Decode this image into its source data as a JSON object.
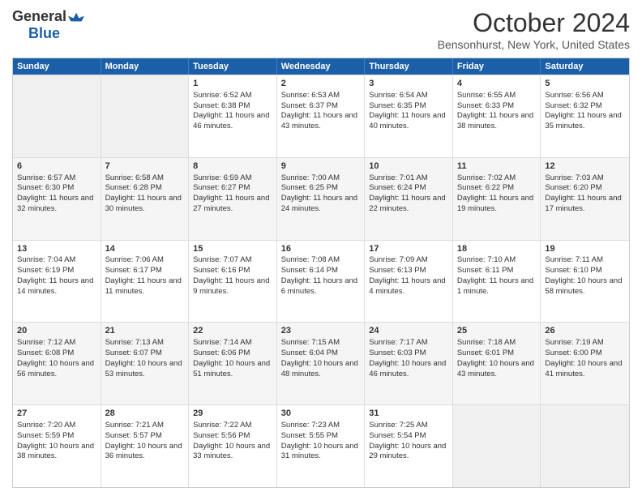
{
  "header": {
    "logo": {
      "general": "General",
      "blue": "Blue"
    },
    "title": "October 2024",
    "location": "Bensonhurst, New York, United States"
  },
  "days_of_week": [
    "Sunday",
    "Monday",
    "Tuesday",
    "Wednesday",
    "Thursday",
    "Friday",
    "Saturday"
  ],
  "weeks": [
    [
      {
        "day": "",
        "sunrise": "",
        "sunset": "",
        "daylight": ""
      },
      {
        "day": "",
        "sunrise": "",
        "sunset": "",
        "daylight": ""
      },
      {
        "day": "1",
        "sunrise": "Sunrise: 6:52 AM",
        "sunset": "Sunset: 6:38 PM",
        "daylight": "Daylight: 11 hours and 46 minutes."
      },
      {
        "day": "2",
        "sunrise": "Sunrise: 6:53 AM",
        "sunset": "Sunset: 6:37 PM",
        "daylight": "Daylight: 11 hours and 43 minutes."
      },
      {
        "day": "3",
        "sunrise": "Sunrise: 6:54 AM",
        "sunset": "Sunset: 6:35 PM",
        "daylight": "Daylight: 11 hours and 40 minutes."
      },
      {
        "day": "4",
        "sunrise": "Sunrise: 6:55 AM",
        "sunset": "Sunset: 6:33 PM",
        "daylight": "Daylight: 11 hours and 38 minutes."
      },
      {
        "day": "5",
        "sunrise": "Sunrise: 6:56 AM",
        "sunset": "Sunset: 6:32 PM",
        "daylight": "Daylight: 11 hours and 35 minutes."
      }
    ],
    [
      {
        "day": "6",
        "sunrise": "Sunrise: 6:57 AM",
        "sunset": "Sunset: 6:30 PM",
        "daylight": "Daylight: 11 hours and 32 minutes."
      },
      {
        "day": "7",
        "sunrise": "Sunrise: 6:58 AM",
        "sunset": "Sunset: 6:28 PM",
        "daylight": "Daylight: 11 hours and 30 minutes."
      },
      {
        "day": "8",
        "sunrise": "Sunrise: 6:59 AM",
        "sunset": "Sunset: 6:27 PM",
        "daylight": "Daylight: 11 hours and 27 minutes."
      },
      {
        "day": "9",
        "sunrise": "Sunrise: 7:00 AM",
        "sunset": "Sunset: 6:25 PM",
        "daylight": "Daylight: 11 hours and 24 minutes."
      },
      {
        "day": "10",
        "sunrise": "Sunrise: 7:01 AM",
        "sunset": "Sunset: 6:24 PM",
        "daylight": "Daylight: 11 hours and 22 minutes."
      },
      {
        "day": "11",
        "sunrise": "Sunrise: 7:02 AM",
        "sunset": "Sunset: 6:22 PM",
        "daylight": "Daylight: 11 hours and 19 minutes."
      },
      {
        "day": "12",
        "sunrise": "Sunrise: 7:03 AM",
        "sunset": "Sunset: 6:20 PM",
        "daylight": "Daylight: 11 hours and 17 minutes."
      }
    ],
    [
      {
        "day": "13",
        "sunrise": "Sunrise: 7:04 AM",
        "sunset": "Sunset: 6:19 PM",
        "daylight": "Daylight: 11 hours and 14 minutes."
      },
      {
        "day": "14",
        "sunrise": "Sunrise: 7:06 AM",
        "sunset": "Sunset: 6:17 PM",
        "daylight": "Daylight: 11 hours and 11 minutes."
      },
      {
        "day": "15",
        "sunrise": "Sunrise: 7:07 AM",
        "sunset": "Sunset: 6:16 PM",
        "daylight": "Daylight: 11 hours and 9 minutes."
      },
      {
        "day": "16",
        "sunrise": "Sunrise: 7:08 AM",
        "sunset": "Sunset: 6:14 PM",
        "daylight": "Daylight: 11 hours and 6 minutes."
      },
      {
        "day": "17",
        "sunrise": "Sunrise: 7:09 AM",
        "sunset": "Sunset: 6:13 PM",
        "daylight": "Daylight: 11 hours and 4 minutes."
      },
      {
        "day": "18",
        "sunrise": "Sunrise: 7:10 AM",
        "sunset": "Sunset: 6:11 PM",
        "daylight": "Daylight: 11 hours and 1 minute."
      },
      {
        "day": "19",
        "sunrise": "Sunrise: 7:11 AM",
        "sunset": "Sunset: 6:10 PM",
        "daylight": "Daylight: 10 hours and 58 minutes."
      }
    ],
    [
      {
        "day": "20",
        "sunrise": "Sunrise: 7:12 AM",
        "sunset": "Sunset: 6:08 PM",
        "daylight": "Daylight: 10 hours and 56 minutes."
      },
      {
        "day": "21",
        "sunrise": "Sunrise: 7:13 AM",
        "sunset": "Sunset: 6:07 PM",
        "daylight": "Daylight: 10 hours and 53 minutes."
      },
      {
        "day": "22",
        "sunrise": "Sunrise: 7:14 AM",
        "sunset": "Sunset: 6:06 PM",
        "daylight": "Daylight: 10 hours and 51 minutes."
      },
      {
        "day": "23",
        "sunrise": "Sunrise: 7:15 AM",
        "sunset": "Sunset: 6:04 PM",
        "daylight": "Daylight: 10 hours and 48 minutes."
      },
      {
        "day": "24",
        "sunrise": "Sunrise: 7:17 AM",
        "sunset": "Sunset: 6:03 PM",
        "daylight": "Daylight: 10 hours and 46 minutes."
      },
      {
        "day": "25",
        "sunrise": "Sunrise: 7:18 AM",
        "sunset": "Sunset: 6:01 PM",
        "daylight": "Daylight: 10 hours and 43 minutes."
      },
      {
        "day": "26",
        "sunrise": "Sunrise: 7:19 AM",
        "sunset": "Sunset: 6:00 PM",
        "daylight": "Daylight: 10 hours and 41 minutes."
      }
    ],
    [
      {
        "day": "27",
        "sunrise": "Sunrise: 7:20 AM",
        "sunset": "Sunset: 5:59 PM",
        "daylight": "Daylight: 10 hours and 38 minutes."
      },
      {
        "day": "28",
        "sunrise": "Sunrise: 7:21 AM",
        "sunset": "Sunset: 5:57 PM",
        "daylight": "Daylight: 10 hours and 36 minutes."
      },
      {
        "day": "29",
        "sunrise": "Sunrise: 7:22 AM",
        "sunset": "Sunset: 5:56 PM",
        "daylight": "Daylight: 10 hours and 33 minutes."
      },
      {
        "day": "30",
        "sunrise": "Sunrise: 7:23 AM",
        "sunset": "Sunset: 5:55 PM",
        "daylight": "Daylight: 10 hours and 31 minutes."
      },
      {
        "day": "31",
        "sunrise": "Sunrise: 7:25 AM",
        "sunset": "Sunset: 5:54 PM",
        "daylight": "Daylight: 10 hours and 29 minutes."
      },
      {
        "day": "",
        "sunrise": "",
        "sunset": "",
        "daylight": ""
      },
      {
        "day": "",
        "sunrise": "",
        "sunset": "",
        "daylight": ""
      }
    ]
  ]
}
